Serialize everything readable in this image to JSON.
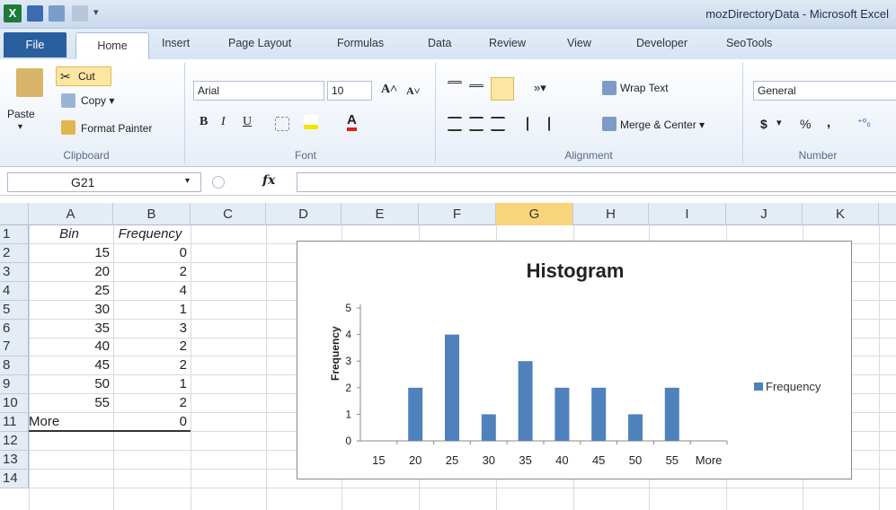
{
  "window": {
    "title": "mozDirectoryData - Microsoft Excel"
  },
  "tabs": {
    "file": "File",
    "home": "Home",
    "insert": "Insert",
    "page_layout": "Page Layout",
    "formulas": "Formulas",
    "data": "Data",
    "review": "Review",
    "view": "View",
    "developer": "Developer",
    "seotools": "SeoTools"
  },
  "ribbon": {
    "clipboard": {
      "label": "Clipboard",
      "paste": "Paste",
      "cut": "Cut",
      "copy": "Copy ▾",
      "format_painter": "Format Painter"
    },
    "font": {
      "label": "Font",
      "name": "Arial",
      "size": "10",
      "bold": "B",
      "italic": "I",
      "underline": "U"
    },
    "alignment": {
      "label": "Alignment",
      "wrap_text": "Wrap Text",
      "merge_center": "Merge & Center ▾"
    },
    "number": {
      "label": "Number",
      "format": "General",
      "currency": "$",
      "percent": "%",
      "comma": ","
    }
  },
  "formula_bar": {
    "name_box": "G21",
    "fx": "fx",
    "value": ""
  },
  "columns": [
    "A",
    "B",
    "C",
    "D",
    "E",
    "F",
    "G",
    "H",
    "I",
    "J",
    "K"
  ],
  "rows": [
    "1",
    "2",
    "3",
    "4",
    "5",
    "6",
    "7",
    "8",
    "9",
    "10",
    "11",
    "12",
    "13",
    "14"
  ],
  "table": {
    "headers": [
      "Bin",
      "Frequency"
    ],
    "bins": [
      "15",
      "20",
      "25",
      "30",
      "35",
      "40",
      "45",
      "50",
      "55",
      "More"
    ],
    "frequencies": [
      "0",
      "2",
      "4",
      "1",
      "3",
      "2",
      "2",
      "1",
      "2",
      "0"
    ]
  },
  "chart_data": {
    "type": "bar",
    "title": "Histogram",
    "ylabel": "Frequency",
    "xlabel": "",
    "categories": [
      "15",
      "20",
      "25",
      "30",
      "35",
      "40",
      "45",
      "50",
      "55",
      "More"
    ],
    "series": [
      {
        "name": "Frequency",
        "values": [
          0,
          2,
          4,
          1,
          3,
          2,
          2,
          1,
          2,
          0
        ]
      }
    ],
    "ylim": [
      0,
      5
    ],
    "yticks": [
      "0",
      "1",
      "2",
      "3",
      "4",
      "5"
    ],
    "legend": "right",
    "color": "#4f81bd"
  }
}
